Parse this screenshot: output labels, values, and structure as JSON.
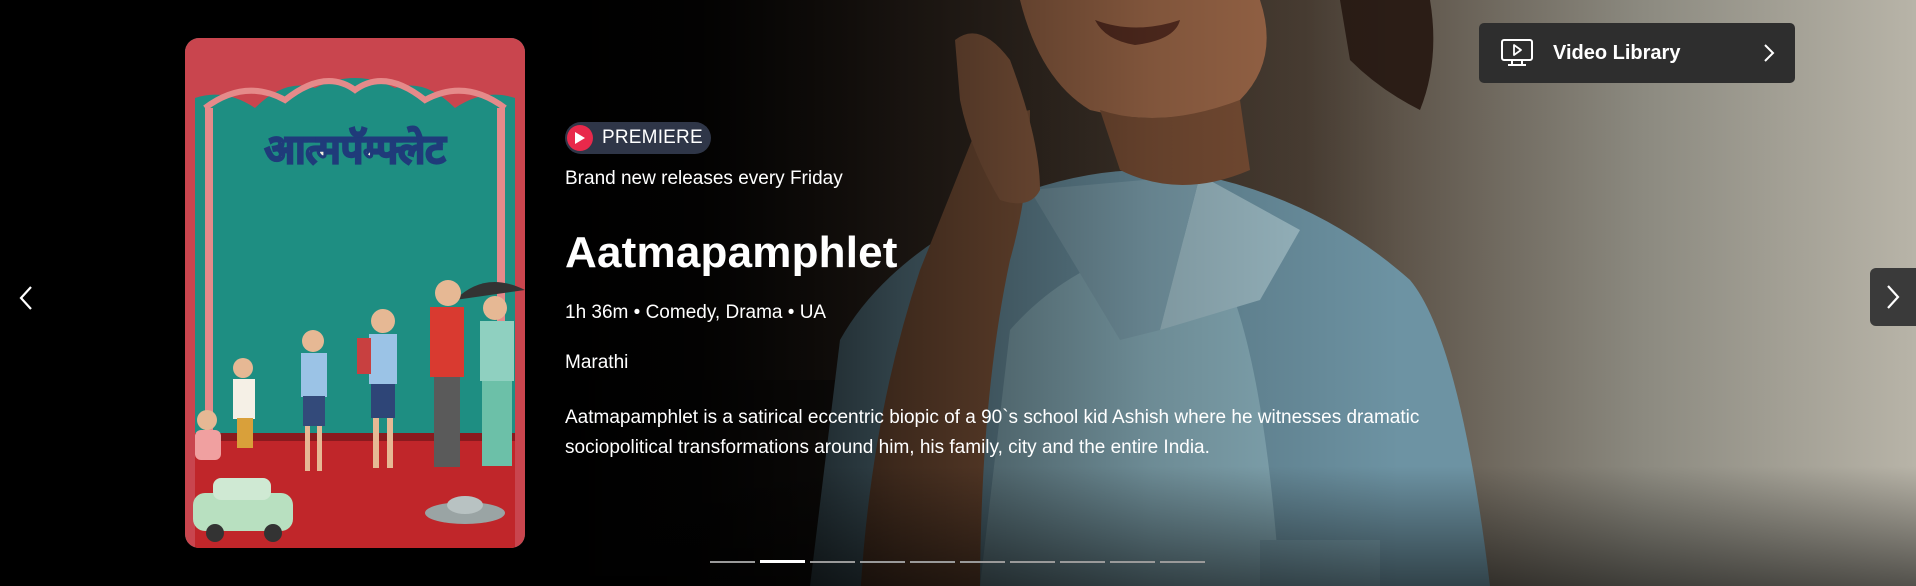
{
  "badge": {
    "label": "PREMIERE"
  },
  "tagline": "Brand new releases every Friday",
  "movie": {
    "title": "Aatmapamphlet",
    "meta": "1h 36m • Comedy, Drama • UA",
    "language": "Marathi",
    "description": "Aatmapamphlet is a satirical eccentric biopic of a 90`s school kid Ashish where he witnesses dramatic sociopolitical transformations around him, his family, city and the entire India.",
    "poster_title": "आत्मपॅम्फ्लेट"
  },
  "video_library": {
    "label": "Video Library",
    "icon": "monitor-play-icon"
  },
  "carousel": {
    "slide_count": 10,
    "active_index": 1
  },
  "colors": {
    "badge_accent": "#e8294b",
    "badge_bg": "#2f3648",
    "button_bg": "#2e2e2e"
  }
}
